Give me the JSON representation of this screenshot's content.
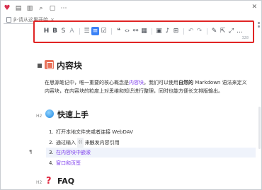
{
  "window": {
    "tab_title": "β-请从这里开始"
  },
  "toolbar": {
    "tools": [
      {
        "icon": "heading-icon",
        "glyph": "H"
      },
      {
        "icon": "bold-icon",
        "glyph": "B"
      },
      {
        "icon": "strikethrough-icon",
        "glyph": "S"
      },
      {
        "icon": "clear-format-icon",
        "glyph": "A"
      },
      {
        "icon": "bullet-list-icon",
        "glyph": "☰"
      },
      {
        "icon": "ordered-list-icon",
        "glyph": "≡"
      },
      {
        "icon": "checkbox-icon",
        "glyph": "☑"
      },
      {
        "icon": "quote-icon",
        "glyph": "❝"
      },
      {
        "icon": "code-icon",
        "glyph": "‹›"
      },
      {
        "icon": "link-icon",
        "glyph": "⚯"
      },
      {
        "icon": "table-icon",
        "glyph": "▦"
      },
      {
        "icon": "image-icon",
        "glyph": "▣"
      },
      {
        "icon": "mic-icon",
        "glyph": "♪"
      },
      {
        "icon": "grid-icon",
        "glyph": "⊞"
      },
      {
        "icon": "undo-icon",
        "glyph": "↶"
      },
      {
        "icon": "redo-icon",
        "glyph": "↷"
      },
      {
        "icon": "pen-icon",
        "glyph": "✎"
      },
      {
        "icon": "export-icon",
        "glyph": "⇱"
      },
      {
        "icon": "fullscreen-icon",
        "glyph": "⤢"
      },
      {
        "icon": "more-icon",
        "glyph": "…"
      }
    ],
    "word_count": "328"
  },
  "content": {
    "h1_title": "内容块",
    "para_1": "在思源笔记中，唯一重要的核心概念是",
    "para_link": "内容块",
    "para_2": "。我们可以使用",
    "para_bold": "自然的",
    "para_3": " Markdown 语法来定义内容块，在内容块的粒度上对思维和知识进行整理，同时也能方便长文排版输出。",
    "h2_marker": "H2",
    "h2_title": "快速上手",
    "list": [
      {
        "num": "1.",
        "text": "打开本地文件夹或者连接 WebDAV"
      },
      {
        "num": "2.",
        "pre": "通过输入",
        "code": "((",
        "post": "来触发内容引用"
      },
      {
        "num": "3.",
        "text": "在内容块中嵌滚"
      },
      {
        "num": "4.",
        "text": "窗口和页签"
      }
    ],
    "pilcrow": "¶",
    "h3_marker": "H2",
    "h3_title": "FAQ"
  }
}
